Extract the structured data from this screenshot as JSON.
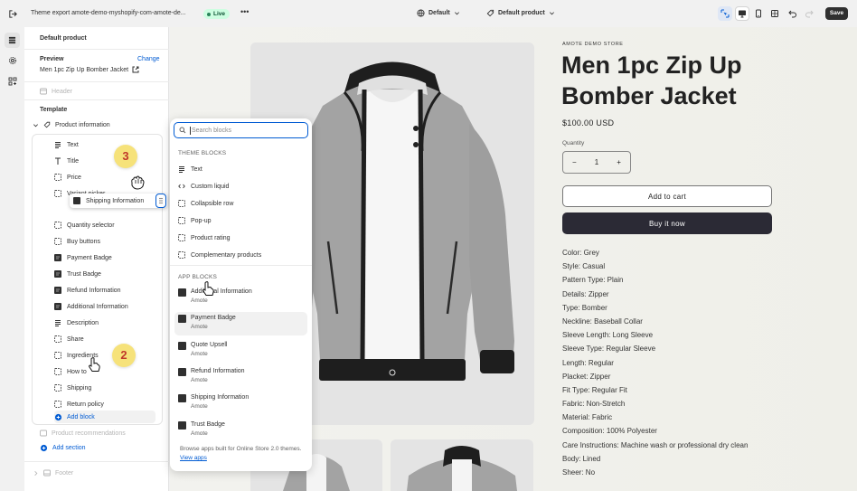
{
  "topbar": {
    "theme_title": "Theme export amote-demo-myshopify-com-amote-de...",
    "status_badge": "Live",
    "more": "•••",
    "store_selector": "Default",
    "template_selector": "Default product",
    "save_label": "Save"
  },
  "sidebar": {
    "title": "Default product",
    "preview_label": "Preview",
    "preview_change": "Change",
    "preview_product": "Men 1pc Zip Up Bomber Jacket",
    "header_section": "Header",
    "template_label": "Template",
    "product_information": "Product information",
    "blocks": [
      {
        "label": "Text",
        "icon": "text-icon"
      },
      {
        "label": "Title",
        "icon": "title-icon"
      },
      {
        "label": "Price",
        "icon": "block-icon"
      },
      {
        "label": "Variant picker",
        "icon": "block-icon"
      },
      {
        "label": "Quantity selector",
        "icon": "block-icon"
      },
      {
        "label": "Buy buttons",
        "icon": "block-icon"
      },
      {
        "label": "Payment Badge",
        "icon": "app-icon"
      },
      {
        "label": "Trust Badge",
        "icon": "app-icon"
      },
      {
        "label": "Refund Information",
        "icon": "app-icon"
      },
      {
        "label": "Additional Information",
        "icon": "app-icon"
      },
      {
        "label": "Description",
        "icon": "text-icon"
      },
      {
        "label": "Share",
        "icon": "block-icon"
      },
      {
        "label": "Ingredients",
        "icon": "block-icon"
      },
      {
        "label": "How to",
        "icon": "block-icon"
      },
      {
        "label": "Shipping",
        "icon": "block-icon"
      },
      {
        "label": "Return policy",
        "icon": "block-icon"
      }
    ],
    "dragging_block": "Shipping Information",
    "add_block": "Add block",
    "product_recommendations": "Product recommendations",
    "add_section": "Add section",
    "footer_section": "Footer",
    "step_badges": [
      "3",
      "2"
    ]
  },
  "picker": {
    "search_placeholder": "Search blocks",
    "theme_blocks_label": "THEME BLOCKS",
    "theme_blocks": [
      {
        "label": "Text",
        "icon": "text-icon"
      },
      {
        "label": "Custom liquid",
        "icon": "code-icon"
      },
      {
        "label": "Collapsible row",
        "icon": "block-icon"
      },
      {
        "label": "Pop-up",
        "icon": "block-icon"
      },
      {
        "label": "Product rating",
        "icon": "block-icon"
      },
      {
        "label": "Complementary products",
        "icon": "block-icon"
      }
    ],
    "app_blocks_label": "APP BLOCKS",
    "app_blocks": [
      {
        "name": "Additional Information",
        "vendor": "Amote"
      },
      {
        "name": "Payment Badge",
        "vendor": "Amote"
      },
      {
        "name": "Quote Upsell",
        "vendor": "Amote"
      },
      {
        "name": "Refund Information",
        "vendor": "Amote"
      },
      {
        "name": "Shipping Information",
        "vendor": "Amote"
      },
      {
        "name": "Trust Badge",
        "vendor": "Amote"
      }
    ],
    "footer_text": "Browse apps built for Online Store 2.0 themes.",
    "footer_link": "View apps"
  },
  "product": {
    "vendor": "AMOTE DEMO STORE",
    "title": "Men 1pc Zip Up Bomber Jacket",
    "price": "$100.00 USD",
    "quantity_label": "Quantity",
    "quantity_minus": "−",
    "quantity_value": "1",
    "quantity_plus": "+",
    "add_to_cart": "Add to cart",
    "buy_now": "Buy it now",
    "specs": [
      "Color: Grey",
      "Style: Casual",
      "Pattern Type: Plain",
      "Details: Zipper",
      "Type: Bomber",
      "Neckline: Baseball Collar",
      "Sleeve Length: Long Sleeve",
      "Sleeve Type: Regular Sleeve",
      "Length: Regular",
      "Placket: Zipper",
      "Fit Type: Regular Fit",
      "Fabric: Non-Stretch",
      "Material: Fabric",
      "Composition: 100% Polyester",
      "Care Instructions: Machine wash or professional dry clean",
      "Body: Lined",
      "Sheer: No"
    ]
  },
  "colors": {
    "accent": "#005bd3",
    "live_bg": "#cdfee1",
    "live_fg": "#0c5132",
    "buy_button": "#2b2a35",
    "badge": "#f6e27a"
  }
}
